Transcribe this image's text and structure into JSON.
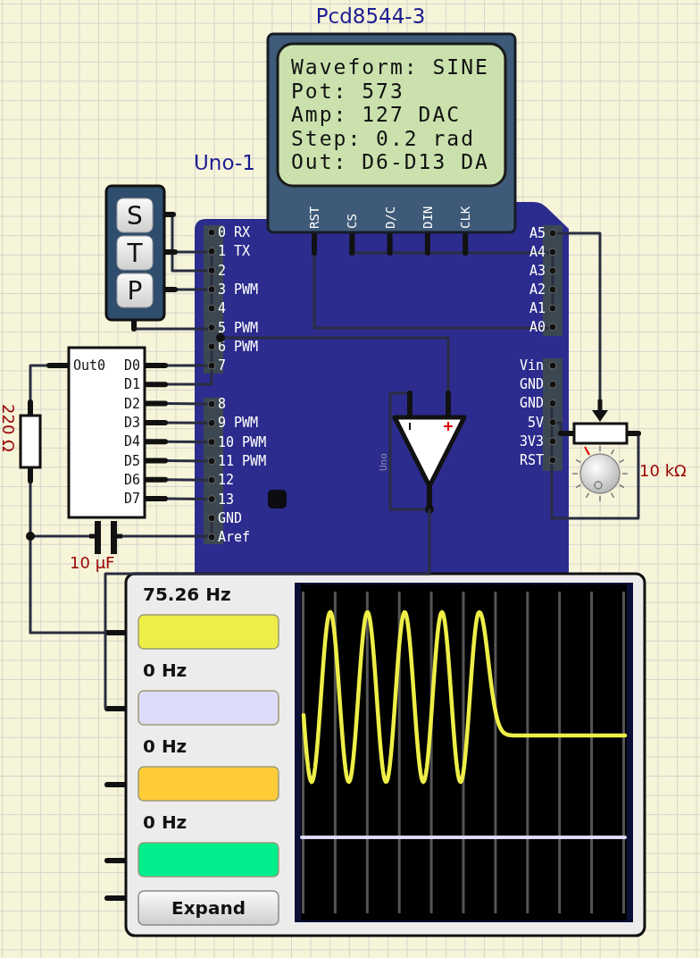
{
  "lcd": {
    "label": "Pcd8544-3",
    "lines": [
      "Waveform: SINE",
      "Pot: 573",
      "Amp: 127 DAC",
      "Step: 0.2 rad",
      "Out: D6-D13 DA"
    ],
    "pins": [
      "RST",
      "CS",
      "D/C",
      "DIN",
      "CLK"
    ]
  },
  "board": {
    "label": "Uno-1",
    "digital_pins": [
      "0 RX",
      "1 TX",
      "2",
      "3 PWM",
      "4",
      "5 PWM",
      "6 PWM",
      "7",
      "8",
      "9 PWM",
      "10 PWM",
      "11 PWM",
      "12",
      "13",
      "GND",
      "Aref"
    ],
    "analog_pins": [
      "A5",
      "A4",
      "A3",
      "A2",
      "A1",
      "A0"
    ],
    "power_pins": [
      "Vin",
      "GND",
      "GND",
      "5V",
      "3V3",
      "RST"
    ]
  },
  "keypad": {
    "keys": [
      "S",
      "T",
      "P"
    ]
  },
  "dac": {
    "output_pin": "Out0",
    "input_pins": [
      "D0",
      "D1",
      "D2",
      "D3",
      "D4",
      "D5",
      "D6",
      "D7"
    ]
  },
  "resistor": {
    "value": "220 Ω"
  },
  "capacitor": {
    "value": "10 µF"
  },
  "op_amp": {
    "label": "Uno"
  },
  "potentiometer": {
    "value": "10 kΩ"
  },
  "oscilloscope": {
    "channels": [
      {
        "frequency": "75.26 Hz",
        "color": "#eeee48"
      },
      {
        "frequency": "0 Hz",
        "color": "#dcdcf8"
      },
      {
        "frequency": "0 Hz",
        "color": "#ffcc38"
      },
      {
        "frequency": "0 Hz",
        "color": "#00ee8c"
      }
    ],
    "expand_button": "Expand"
  }
}
